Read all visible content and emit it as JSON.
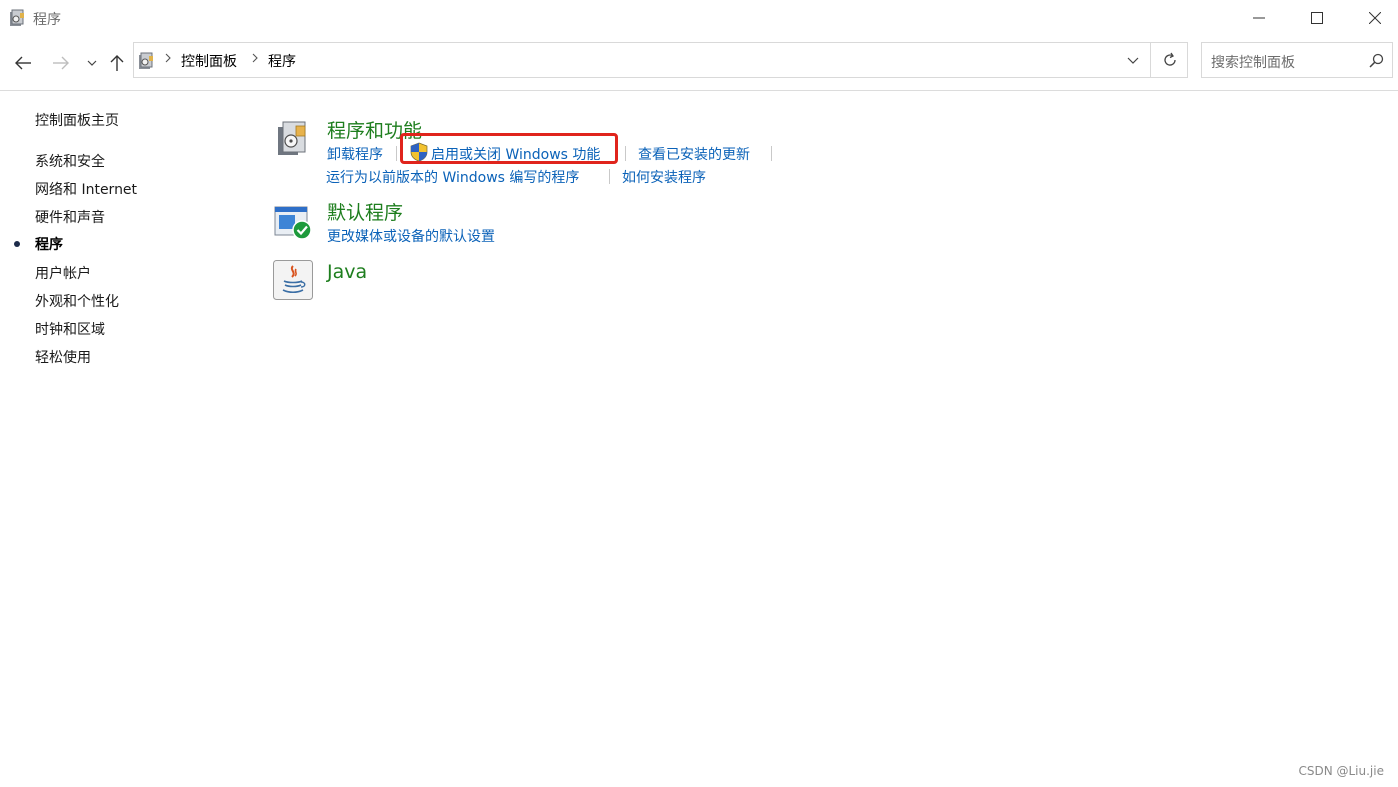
{
  "window": {
    "title": "程序"
  },
  "address": {
    "breadcrumb": [
      "控制面板",
      "程序"
    ],
    "search_placeholder": "搜索控制面板"
  },
  "sidebar": {
    "home": "控制面板主页",
    "items": [
      {
        "label": "系统和安全"
      },
      {
        "label": "网络和 Internet"
      },
      {
        "label": "硬件和声音"
      },
      {
        "label": "程序",
        "active": true
      },
      {
        "label": "用户帐户"
      },
      {
        "label": "外观和个性化"
      },
      {
        "label": "时钟和区域"
      },
      {
        "label": "轻松使用"
      }
    ]
  },
  "categories": [
    {
      "title": "程序和功能",
      "icon": "programs-features-icon",
      "links": [
        {
          "label": "卸载程序"
        },
        {
          "label": "启用或关闭 Windows 功能",
          "icon": "uac-shield-icon",
          "highlighted": true
        },
        {
          "label": "查看已安装的更新"
        },
        {
          "label": "运行为以前版本的 Windows 编写的程序"
        },
        {
          "label": "如何安装程序"
        }
      ]
    },
    {
      "title": "默认程序",
      "icon": "default-programs-icon",
      "links": [
        {
          "label": "更改媒体或设备的默认设置"
        }
      ]
    },
    {
      "title": "Java",
      "icon": "java-icon",
      "links": []
    }
  ],
  "colors": {
    "category_title": "#1e7e1e",
    "link": "#0b62b8",
    "highlight_box": "#e0241c"
  },
  "watermark": "CSDN @Liu.jie"
}
